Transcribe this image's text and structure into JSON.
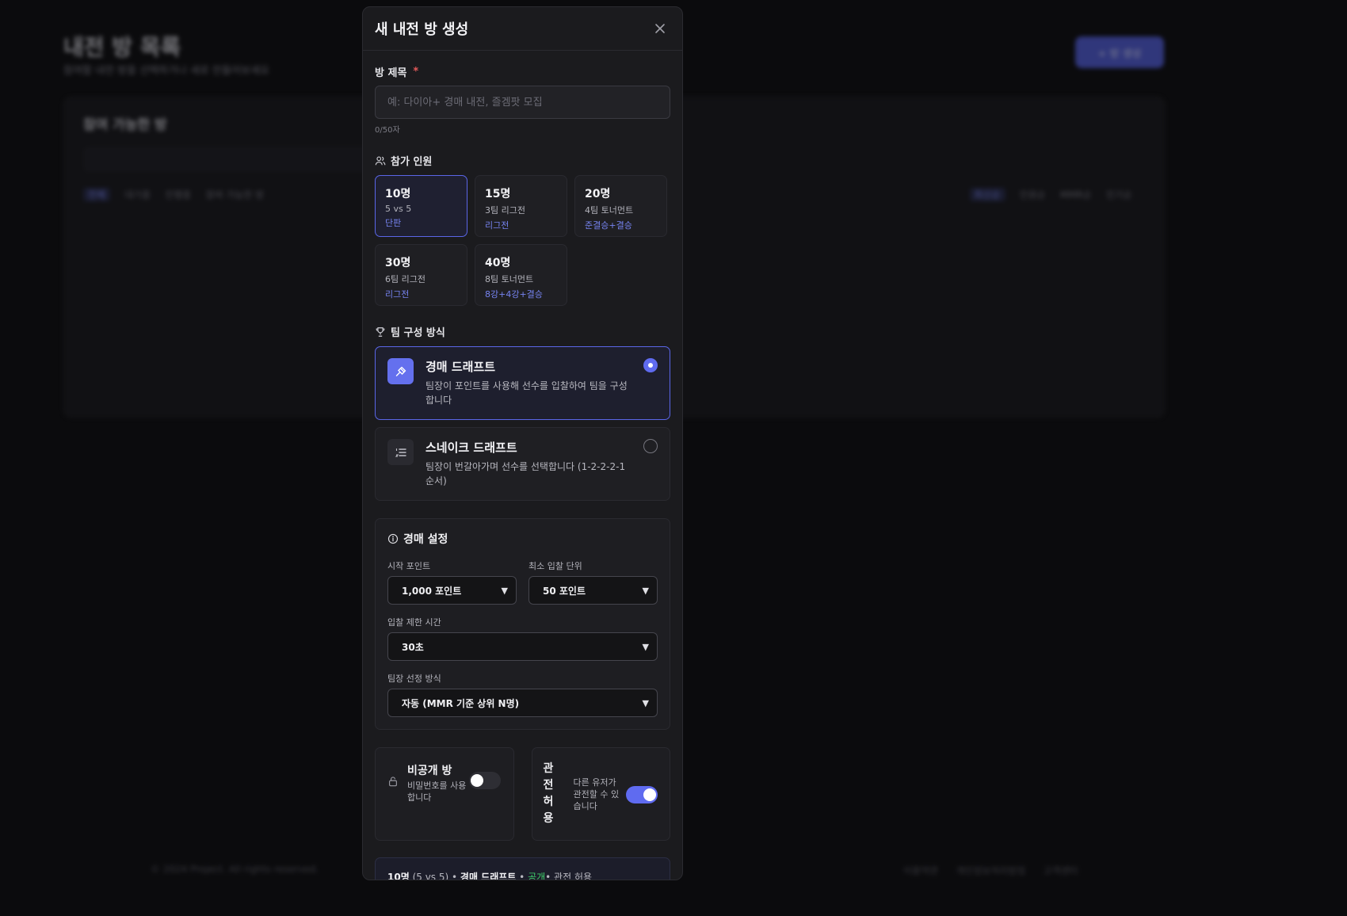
{
  "background": {
    "title": "내전 방 목록",
    "subtitle": "참여할 내전 방을 선택하거나 새로 만들어보세요",
    "create_button": "+ 방 생성",
    "panel_title": "참여 가능한 방",
    "filters": [
      "전체",
      "대기중",
      "진행중",
      "참여 가능한 방"
    ],
    "sort": [
      "최신순",
      "인원순",
      "MMR순",
      "인기순"
    ],
    "footer": "© 2024 Project. All rights reserved.",
    "footer_links": [
      "이용약관",
      "개인정보처리방침",
      "고객센터"
    ]
  },
  "modal": {
    "title": "새 내전 방 생성",
    "close_icon": "close-icon",
    "room_title": {
      "label": "방 제목",
      "required_mark": "*",
      "placeholder": "예: 다이아+ 경매 내전, 즐겜팟 모집",
      "value": "",
      "char_count": "0/50자"
    },
    "players": {
      "label": "참가 인원",
      "icon": "users-icon",
      "options": [
        {
          "count": "10명",
          "desc": "5 vs 5",
          "format": "단판",
          "selected": true
        },
        {
          "count": "15명",
          "desc": "3팀 리그전",
          "format": "리그전",
          "selected": false
        },
        {
          "count": "20명",
          "desc": "4팀 토너먼트",
          "format": "준결승+결승",
          "selected": false
        },
        {
          "count": "30명",
          "desc": "6팀 리그전",
          "format": "리그전",
          "selected": false
        },
        {
          "count": "40명",
          "desc": "8팀 토너먼트",
          "format": "8강+4강+결승",
          "selected": false
        }
      ]
    },
    "team_method": {
      "label": "팀 구성 방식",
      "icon": "trophy-icon",
      "options": [
        {
          "name": "경매 드래프트",
          "desc": "팀장이 포인트를 사용해 선수를 입찰하여 팀을 구성합니다",
          "icon": "gavel-icon",
          "selected": true
        },
        {
          "name": "스네이크 드래프트",
          "desc": "팀장이 번갈아가며 선수를 선택합니다 (1-2-2-2-1 순서)",
          "icon": "list-ordered-icon",
          "selected": false
        }
      ]
    },
    "auction": {
      "title": "경매 설정",
      "icon": "info-icon",
      "start_points_label": "시작 포인트",
      "start_points_value": "1,000 포인트",
      "min_bid_label": "최소 입찰 단위",
      "min_bid_value": "50 포인트",
      "bid_time_label": "입찰 제한 시간",
      "bid_time_value": "30초",
      "captain_label": "팀장 선정 방식",
      "captain_value": "자동 (MMR 기준 상위 N명)"
    },
    "private_room": {
      "title": "비공개 방",
      "desc": "비밀번호를 사용합니다",
      "enabled": false,
      "icon": "lock-icon"
    },
    "spectate": {
      "title": "관전 허용",
      "desc": "다른 유저가 관전할 수 있습니다",
      "enabled": true
    },
    "summary": {
      "count": "10명",
      "match": "(5 vs 5)",
      "sep1": " • ",
      "method": "경매 드래프트",
      "sep2": " • ",
      "visibility": "공개",
      "spectate": "• 관전 허용"
    }
  }
}
